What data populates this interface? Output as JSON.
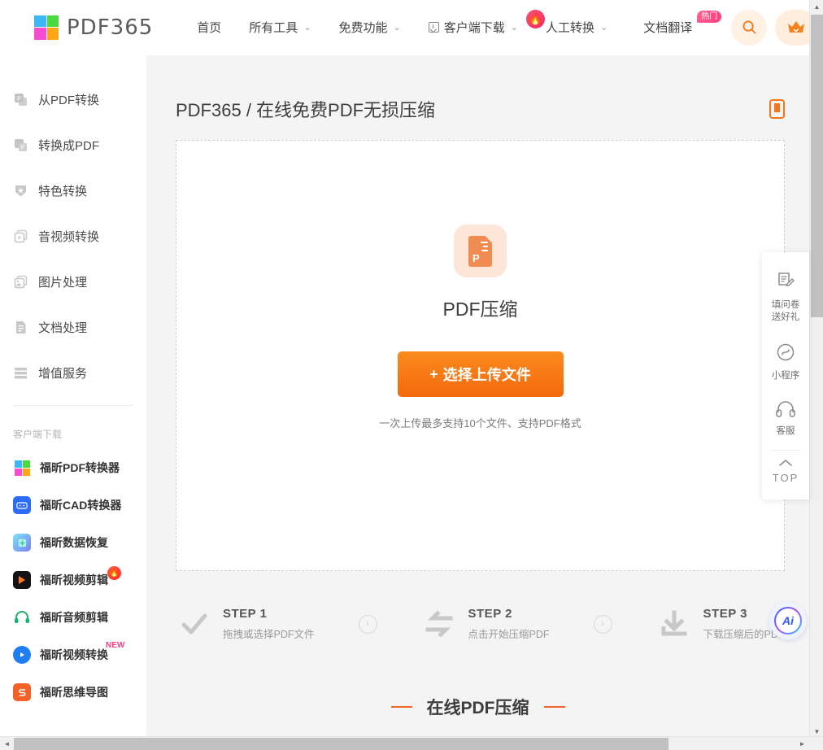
{
  "header": {
    "logo": {
      "text": "PDF365",
      "colors": [
        "#3bb8f5",
        "#4bd940",
        "#f74cd0",
        "#ffa516"
      ]
    },
    "nav": [
      {
        "label": "首页",
        "caret": false,
        "icon": null,
        "badge": null
      },
      {
        "label": "所有工具",
        "caret": true,
        "icon": null,
        "badge": null
      },
      {
        "label": "免费功能",
        "caret": true,
        "icon": null,
        "badge": null
      },
      {
        "label": "客户端下载",
        "caret": true,
        "icon": "download-icon",
        "badge": null
      },
      {
        "label": "人工转换",
        "caret": true,
        "icon": null,
        "badge": "fire"
      },
      {
        "label": "文档翻译",
        "caret": false,
        "icon": null,
        "badge": "热门"
      }
    ],
    "search_icon": "search-icon",
    "vip_icon": "crown-icon",
    "accent": "#f5761a"
  },
  "sidebar": {
    "items": [
      {
        "label": "从PDF转换",
        "icon": "pdf-from-icon"
      },
      {
        "label": "转换成PDF",
        "icon": "pdf-to-icon"
      },
      {
        "label": "特色转换",
        "icon": "star-shield-icon"
      },
      {
        "label": "音视频转换",
        "icon": "media-convert-icon"
      },
      {
        "label": "图片处理",
        "icon": "image-process-icon"
      },
      {
        "label": "文档处理",
        "icon": "document-icon"
      },
      {
        "label": "增值服务",
        "icon": "list-icon"
      }
    ],
    "section_title": "客户端下载",
    "apps": [
      {
        "label": "福昕PDF转换器",
        "icon": "pdf365-tile-icon",
        "color": "grid",
        "badge": null
      },
      {
        "label": "福昕CAD转换器",
        "icon": "cad-icon",
        "color": "#2d6cf6",
        "glyph": "✇",
        "badge": null
      },
      {
        "label": "福昕数据恢复",
        "icon": "data-recovery-icon",
        "color": "#48d1e8",
        "glyph": "✛",
        "badge": null
      },
      {
        "label": "福昕视频剪辑",
        "icon": "video-edit-icon",
        "color": "#1a1a1a",
        "glyph": "▶",
        "badge": "fire"
      },
      {
        "label": "福昕音频剪辑",
        "icon": "audio-edit-icon",
        "color": "#ffffff",
        "glyph": "🎧",
        "badge": null
      },
      {
        "label": "福昕视频转换",
        "icon": "video-convert-icon",
        "color": "#1f7ef5",
        "glyph": "▶",
        "badge": "NEW"
      },
      {
        "label": "福昕思维导图",
        "icon": "mindmap-icon",
        "color": "#f4622a",
        "glyph": "Ǝ",
        "badge": null
      }
    ]
  },
  "main": {
    "page_title": "PDF365 / 在线免费PDF无损压缩",
    "mobile_icon": "mobile-phone-icon",
    "tool_icon": "pdf-compress-icon",
    "tool_name": "PDF压缩",
    "upload_button": "选择上传文件",
    "upload_plus": "+",
    "upload_hint": "一次上传最多支持10个文件、支持PDF格式",
    "steps": [
      {
        "icon": "check-icon",
        "title": "STEP 1",
        "sub": "拖拽或选择PDF文件"
      },
      {
        "icon": "convert-arrows-icon",
        "title": "STEP 2",
        "sub": "点击开始压缩PDF"
      },
      {
        "icon": "download-icon",
        "title": "STEP 3",
        "sub": "下载压缩后的PDF"
      }
    ],
    "step_arrow": "›",
    "section_heading": "在线PDF压缩"
  },
  "float_panel": {
    "items": [
      {
        "icon": "survey-icon",
        "label_line1": "填问卷",
        "label_line2": "送好礼"
      },
      {
        "icon": "miniprogram-icon",
        "label_line1": "小程序",
        "label_line2": ""
      },
      {
        "icon": "headset-icon",
        "label_line1": "客服",
        "label_line2": ""
      }
    ],
    "top_label": "TOP",
    "top_icon": "chevron-up-icon"
  },
  "ai_float": {
    "label": "Ai",
    "icon": "ai-assistant-icon"
  },
  "scrollbars": {
    "up_arrow": "▲",
    "down_arrow": "▼",
    "left_arrow": "◄",
    "right_arrow": "►"
  }
}
